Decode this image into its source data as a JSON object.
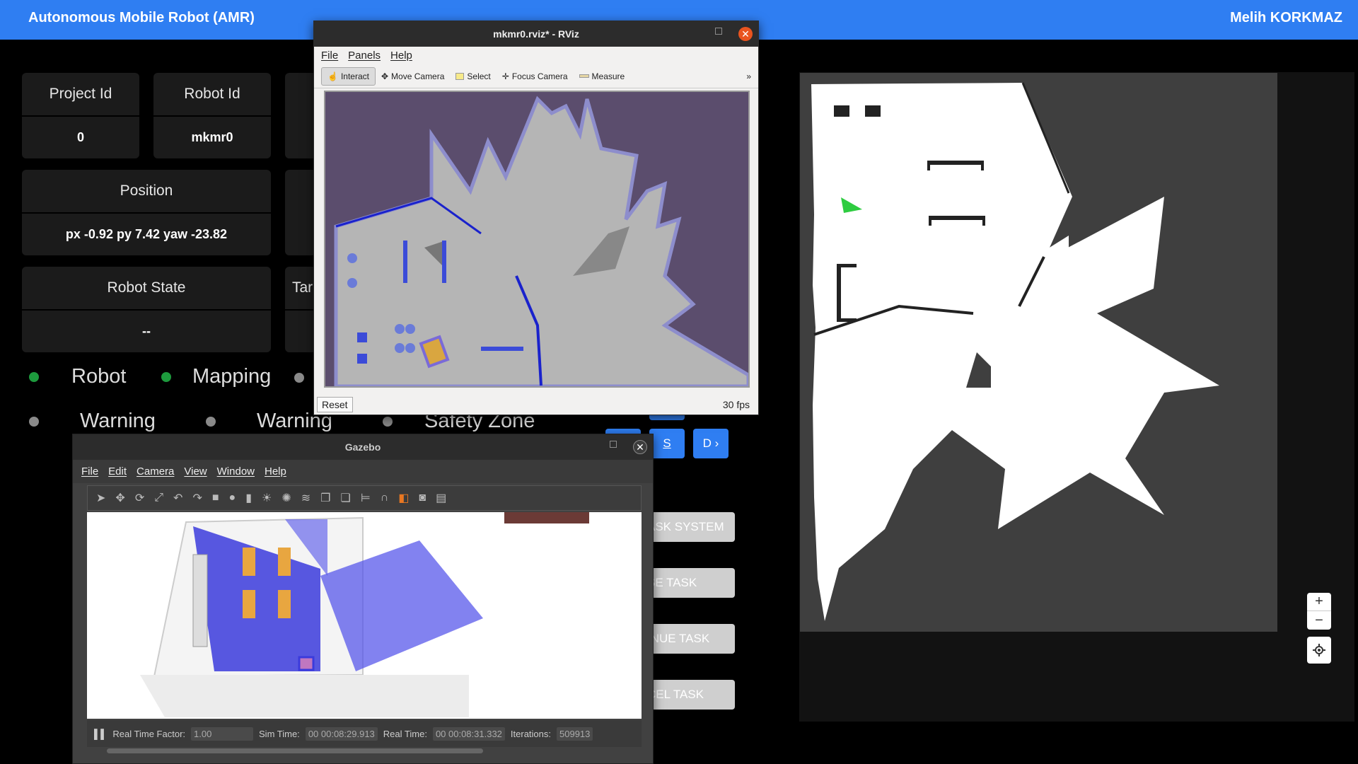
{
  "app": {
    "title": "Autonomous Mobile Robot (AMR)",
    "user": "Melih KORKMAZ"
  },
  "cards": {
    "project_id": {
      "label": "Project Id",
      "value": "0"
    },
    "robot_id": {
      "label": "Robot Id",
      "value": "mkmr0"
    },
    "position": {
      "label": "Position",
      "value": "px -0.92 py 7.42 yaw -23.82"
    },
    "robot_state": {
      "label": "Robot State",
      "value": "--"
    },
    "target_partial": {
      "label": "Tar"
    }
  },
  "indicators": [
    {
      "label": "Robot",
      "status": "on"
    },
    {
      "label": "Mapping",
      "status": "on"
    },
    {
      "label": "Warning",
      "status": "off"
    },
    {
      "label": "Warning",
      "status": "off"
    },
    {
      "label": "Safety Zone",
      "status": "off"
    }
  ],
  "nav_buttons": {
    "s": "S",
    "d": "D ›"
  },
  "task_buttons": [
    "ASK SYSTEM",
    "SE TASK",
    "INUE TASK",
    "CEL TASK"
  ],
  "map_controls": {
    "zoom_in": "+",
    "zoom_out": "−"
  },
  "rviz": {
    "title": "mkmr0.rviz* - RViz",
    "menu": [
      "File",
      "Panels",
      "Help"
    ],
    "tools": [
      "Interact",
      "Move Camera",
      "Select",
      "Focus Camera",
      "Measure"
    ],
    "reset": "Reset",
    "fps": "30 fps"
  },
  "gazebo": {
    "title": "Gazebo",
    "menu": [
      "File",
      "Edit",
      "Camera",
      "View",
      "Window",
      "Help"
    ],
    "status": {
      "rtf_label": "Real Time Factor:",
      "rtf": "1.00",
      "sim_label": "Sim Time:",
      "sim": "00 00:08:29.913",
      "real_label": "Real Time:",
      "real": "00 00:08:31.332",
      "iter_label": "Iterations:",
      "iter": "509913"
    }
  },
  "colors": {
    "brand": "#2f7ef2",
    "on": "#1d9a3d",
    "off": "#8a8a8a",
    "robot_marker": "#2ecc40"
  }
}
